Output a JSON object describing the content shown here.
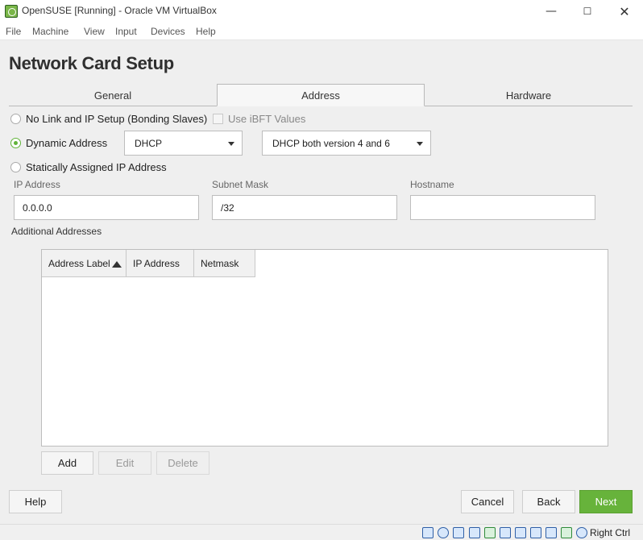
{
  "window": {
    "title": "OpenSUSE [Running] - Oracle VM VirtualBox",
    "controls": {
      "minimize": "—",
      "maximize": "☐",
      "close": "✕"
    }
  },
  "menubar": {
    "items": [
      "File",
      "Machine",
      "View",
      "Input",
      "Devices",
      "Help"
    ]
  },
  "page": {
    "title": "Network Card Setup"
  },
  "tabs": [
    {
      "label": "General",
      "active": false
    },
    {
      "label": "Address",
      "active": true
    },
    {
      "label": "Hardware",
      "active": false
    }
  ],
  "options": {
    "no_link": {
      "label": "No Link and IP Setup (Bonding Slaves)",
      "checked": false
    },
    "use_ibft": {
      "label": "Use iBFT Values",
      "checked": false,
      "enabled": false
    },
    "dynamic": {
      "label": "Dynamic Address",
      "checked": true
    },
    "dynamic_mode": {
      "value": "DHCP"
    },
    "dhcp_version": {
      "value": "DHCP both version 4 and 6"
    },
    "static": {
      "label": "Statically Assigned IP Address",
      "checked": false
    }
  },
  "fields": {
    "ip_address": {
      "label": "IP Address",
      "value": "0.0.0.0"
    },
    "subnet_mask": {
      "label": "Subnet Mask",
      "value": "/32"
    },
    "hostname": {
      "label": "Hostname",
      "value": ""
    }
  },
  "additional": {
    "label": "Additional Addresses",
    "columns": [
      "Address Label",
      "IP Address",
      "Netmask"
    ],
    "sorted_column": "Address Label",
    "rows": []
  },
  "table_buttons": {
    "add": "Add",
    "edit": "Edit",
    "delete": "Delete"
  },
  "footer": {
    "help": "Help",
    "cancel": "Cancel",
    "back": "Back",
    "next": "Next"
  },
  "statusbar": {
    "icons": [
      "hard-disk-icon",
      "optical-drive-icon",
      "audio-icon",
      "network-icon",
      "usb-icon",
      "shared-folders-icon",
      "display-icon",
      "video-capture-icon",
      "recording-icon",
      "cpu-icon",
      "mouse-integration-icon",
      "arrow-down-icon"
    ],
    "host_key": "Right Ctrl"
  },
  "colors": {
    "accent": "#67b33b",
    "radio_checked": "#61b33a"
  }
}
